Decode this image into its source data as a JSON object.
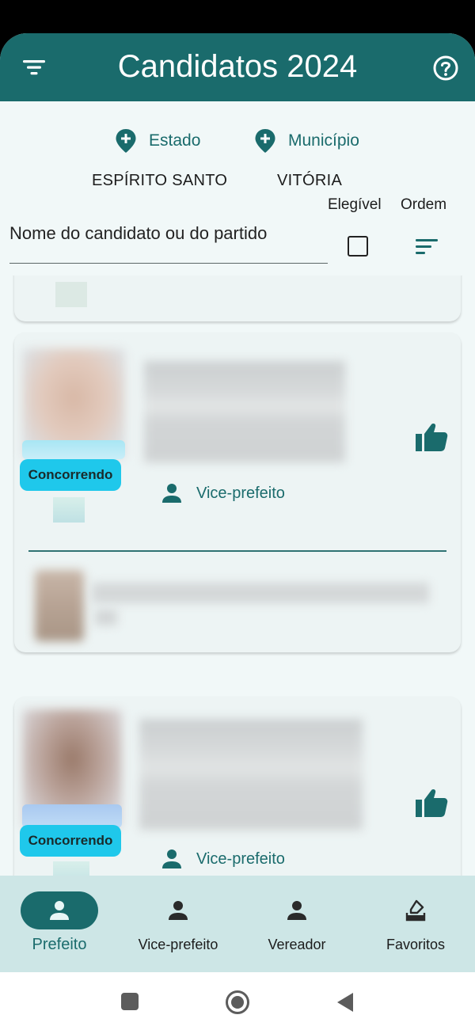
{
  "app": {
    "title": "Candidatos 2024"
  },
  "location": {
    "state_label": "Estado",
    "municipality_label": "Município",
    "state_value": "ESPÍRITO SANTO",
    "municipality_value": "VITÓRIA"
  },
  "filters": {
    "search_placeholder": "Nome do candidato ou do partido",
    "eligible_label": "Elegível",
    "order_label": "Ordem",
    "eligible_checked": false
  },
  "cards": [
    {
      "status": "Concorrendo",
      "running_mate_label": "Vice-prefeito"
    },
    {
      "status": "Concorrendo",
      "running_mate_label": "Vice-prefeito"
    }
  ],
  "bottom_nav": {
    "items": [
      {
        "label": "Prefeito",
        "icon": "person-icon",
        "active": true
      },
      {
        "label": "Vice-prefeito",
        "icon": "person-icon",
        "active": false
      },
      {
        "label": "Vereador",
        "icon": "person-icon",
        "active": false
      },
      {
        "label": "Favoritos",
        "icon": "ballot-box-icon",
        "active": false
      }
    ]
  },
  "colors": {
    "primary": "#1a6b6c",
    "badge": "#1fc8eb",
    "background": "#f1f8f8",
    "bottom_nav": "#cde6e6"
  }
}
